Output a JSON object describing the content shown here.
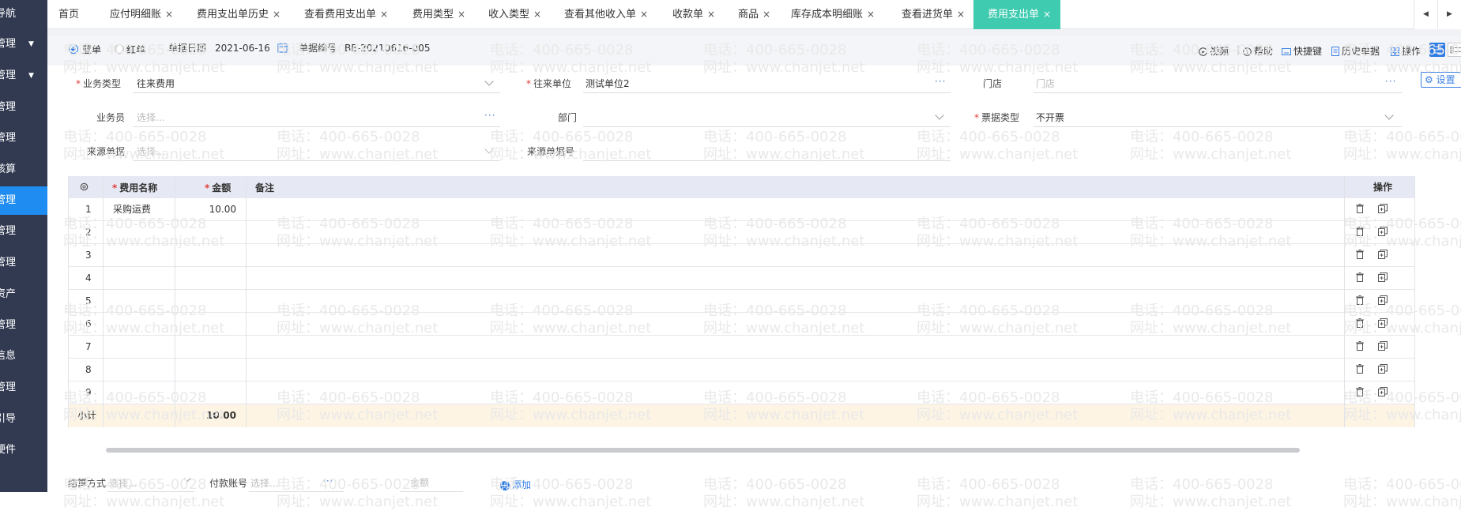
{
  "sidebar": {
    "items": [
      {
        "label": "导航",
        "arrow": "",
        "active": false
      },
      {
        "label": "管理",
        "arrow": "▼",
        "active": false
      },
      {
        "label": "管理",
        "arrow": "▼",
        "active": false
      },
      {
        "label": "管理",
        "arrow": "",
        "active": false
      },
      {
        "label": "管理",
        "arrow": "",
        "active": false
      },
      {
        "label": "核算",
        "arrow": "",
        "active": false
      },
      {
        "label": "管理",
        "arrow": "",
        "active": true
      },
      {
        "label": "管理",
        "arrow": "",
        "active": false
      },
      {
        "label": "管理",
        "arrow": "",
        "active": false
      },
      {
        "label": "资产",
        "arrow": "",
        "active": false
      },
      {
        "label": "管理",
        "arrow": "",
        "active": false
      },
      {
        "label": "信息",
        "arrow": "",
        "active": false
      },
      {
        "label": "管理",
        "arrow": "",
        "active": false
      },
      {
        "label": "引导",
        "arrow": "",
        "active": false
      },
      {
        "label": "硬件",
        "arrow": "",
        "active": false
      }
    ]
  },
  "tabs": [
    {
      "label": "首页",
      "close": ""
    },
    {
      "label": "应付明细账",
      "close": "×"
    },
    {
      "label": "费用支出单历史",
      "close": "×"
    },
    {
      "label": "查看费用支出单",
      "close": "×"
    },
    {
      "label": "费用类型",
      "close": "×"
    },
    {
      "label": "收入类型",
      "close": "×"
    },
    {
      "label": "查看其他收入单",
      "close": "×"
    },
    {
      "label": "收款单",
      "close": "×"
    },
    {
      "label": "商品",
      "close": "×"
    },
    {
      "label": "库存成本明细账",
      "close": "×"
    },
    {
      "label": "查看进货单",
      "close": "×"
    },
    {
      "label": "费用支出单",
      "close": "×",
      "active": true
    }
  ],
  "tab_nav": {
    "prev": "◀",
    "next": "▶"
  },
  "topbar": {
    "blue_label": "蓝单",
    "red_label": "红单",
    "date_label": "单据日期",
    "date_value": "2021-06-16",
    "number_label": "单据编号",
    "number_value": "BE-20210616-005",
    "tools": [
      "视频",
      "帮助",
      "快捷键",
      "历史单据",
      "操作"
    ]
  },
  "form": {
    "biz_type_label": "业务类型",
    "biz_type_value": "往来费用",
    "partner_label": "往来单位",
    "partner_value": "测试单位2",
    "store_label": "门店",
    "store_placeholder": "门店",
    "settings_label": "设置",
    "staff_label": "业务员",
    "staff_placeholder": "选择...",
    "dept_label": "部门",
    "invoice_label": "票据类型",
    "invoice_value": "不开票",
    "source_label": "来源单据",
    "source_placeholder": "选择...",
    "source_no_label": "来源单据号",
    "more": "···"
  },
  "table": {
    "headers": {
      "name": "费用名称",
      "amount": "金额",
      "remark": "备注",
      "op": "操作"
    },
    "rows": [
      {
        "no": "1",
        "name": "采购运费",
        "amount": "10.00"
      },
      {
        "no": "2",
        "name": "",
        "amount": ""
      },
      {
        "no": "3",
        "name": "",
        "amount": ""
      },
      {
        "no": "4",
        "name": "",
        "amount": ""
      },
      {
        "no": "5",
        "name": "",
        "amount": ""
      },
      {
        "no": "6",
        "name": "",
        "amount": ""
      },
      {
        "no": "7",
        "name": "",
        "amount": ""
      },
      {
        "no": "8",
        "name": "",
        "amount": ""
      },
      {
        "no": "9",
        "name": "",
        "amount": ""
      }
    ],
    "subtotal_label": "小计",
    "subtotal_value": "10.00"
  },
  "footer": {
    "settle_label": "结算方式",
    "settle_placeholder": "选择...",
    "account_label": "付款账号",
    "account_placeholder": "选择...",
    "amount_placeholder": "金额",
    "add_label": "添加"
  },
  "watermark": {
    "phone": "电话：400-665-0028",
    "site": "网址：www.chanjet.net"
  }
}
